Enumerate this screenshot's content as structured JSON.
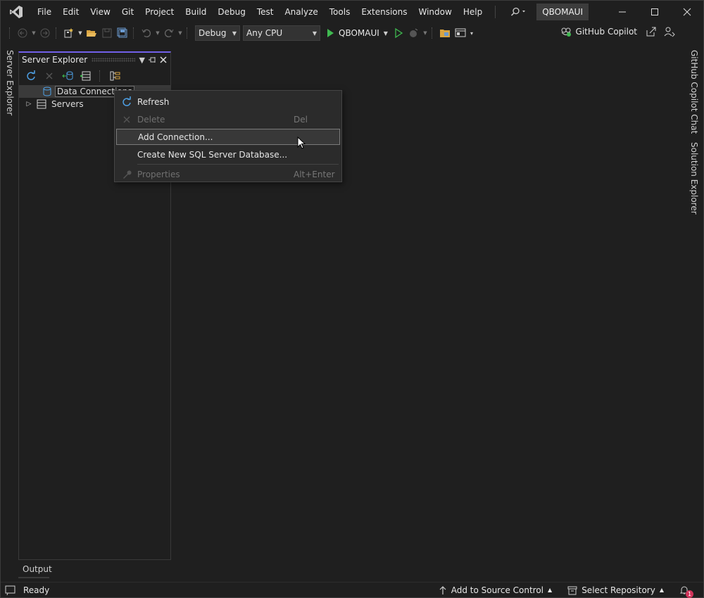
{
  "menu": {
    "items": [
      "File",
      "Edit",
      "View",
      "Git",
      "Project",
      "Build",
      "Debug",
      "Test",
      "Analyze",
      "Tools",
      "Extensions",
      "Window",
      "Help"
    ],
    "project_name": "QBOMAUI"
  },
  "toolbar": {
    "config_value": "Debug",
    "platform_value": "Any CPU",
    "run_target": "QBOMAUI",
    "copilot_label": "GitHub Copilot"
  },
  "side_tabs": {
    "left": "Server Explorer",
    "right": [
      "GitHub Copilot Chat",
      "Solution Explorer"
    ]
  },
  "panel": {
    "title": "Server Explorer",
    "tree": [
      {
        "label": "Data Connections",
        "selected": true,
        "expander": ""
      },
      {
        "label": "Servers",
        "selected": false,
        "expander": "▷"
      }
    ]
  },
  "context_menu": {
    "items": [
      {
        "label": "Refresh",
        "shortcut": "",
        "icon": "refresh-icon",
        "enabled": true
      },
      {
        "label": "Delete",
        "shortcut": "Del",
        "icon": "delete-icon",
        "enabled": false
      },
      {
        "label": "Add Connection...",
        "shortcut": "",
        "icon": "",
        "enabled": true
      },
      {
        "label": "Create New SQL Server Database...",
        "shortcut": "",
        "icon": "",
        "enabled": true
      },
      {
        "label": "Properties",
        "shortcut": "Alt+Enter",
        "icon": "wrench-icon",
        "enabled": false
      }
    ]
  },
  "output_tab": "Output",
  "status": {
    "ready": "Ready",
    "source_control": "Add to Source Control",
    "repository": "Select Repository",
    "notifications": "1"
  },
  "colors": {
    "accent": "#7160e8",
    "play": "#3fb950",
    "background": "#1f1f1f"
  }
}
